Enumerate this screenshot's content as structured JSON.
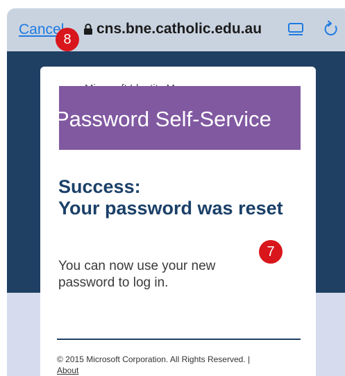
{
  "browser": {
    "cancel_label": "Cancel",
    "url": "cns.bne.catholic.edu.au",
    "icons": [
      "lock-icon",
      "reader-mode-icon",
      "reload-icon"
    ]
  },
  "annotations": {
    "badge_cancel": "8",
    "badge_message": "7"
  },
  "card": {
    "header_text": "Microsoft Identity Manager",
    "banner_text": "Password Self-Service",
    "heading_line1": "Success:",
    "heading_line2": "Your password was reset",
    "message": "You can now use your new password to log in.",
    "footer_text": "© 2015 Microsoft Corporation. All Rights Reserved. |",
    "footer_link": "About"
  },
  "colors": {
    "toolbar_bg": "#c9d3e0",
    "link_blue": "#1e7ae0",
    "page_navy": "#1f3f63",
    "banner_purple": "#8159a1",
    "heading_navy": "#1b4068",
    "badge_red": "#d8161c"
  }
}
